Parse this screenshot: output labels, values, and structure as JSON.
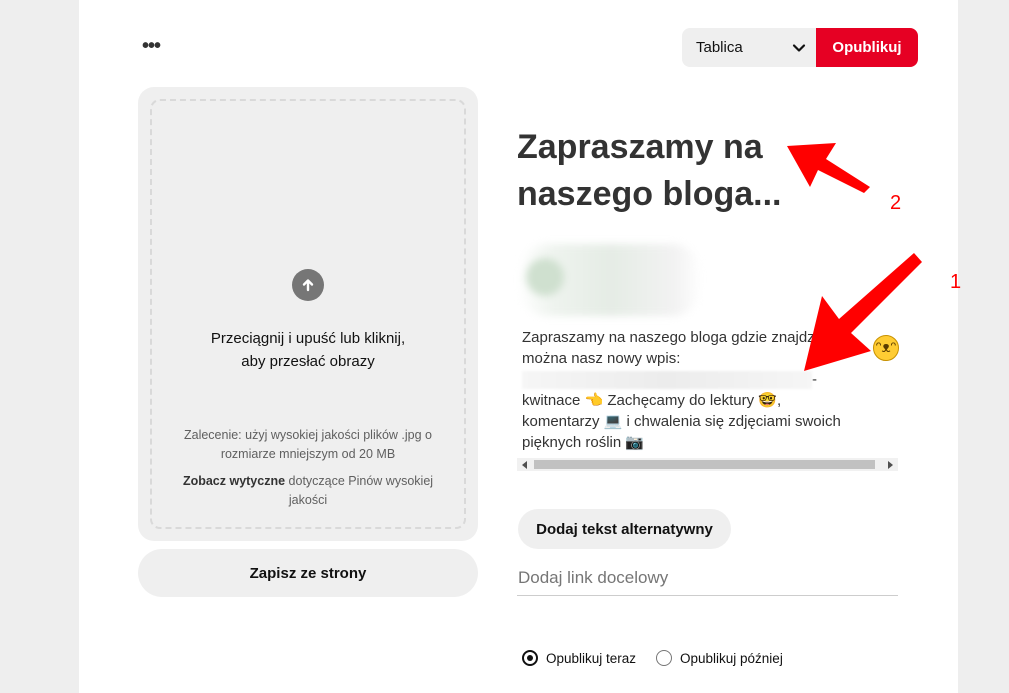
{
  "header": {
    "more_label": "•••",
    "board_select_value": "Tablica",
    "publish_label": "Opublikuj"
  },
  "upload": {
    "instruction_line1": "Przeciągnij i upuść lub kliknij,",
    "instruction_line2": "aby przesłać obrazy",
    "recommendation": "Zalecenie: użyj wysokiej jakości plików .jpg o rozmiarze mniejszym od 20 MB",
    "guidelines_link": "Zobacz wytyczne",
    "guidelines_rest": " dotyczące Pinów wysokiej jakości",
    "save_from_site_label": "Zapisz ze strony"
  },
  "pin": {
    "title": "Zapraszamy na naszego bloga...",
    "description": {
      "line1": "Zapraszamy na naszego bloga gdzie znajdziesz",
      "line2": "można nasz nowy wpis:",
      "line3_suffix": "-",
      "line4": "kwitnace 👈 Zachęcamy do lektury 🤓,",
      "line5": "komentarzy 💻 i chwalenia się zdjęciami swoich",
      "line6": "pięknych roślin 📷"
    },
    "alt_text_button_label": "Dodaj tekst alternatywny",
    "link_placeholder": "Dodaj link docelowy"
  },
  "publish_options": {
    "now_label": "Opublikuj teraz",
    "later_label": "Opublikuj później",
    "selected": "now"
  },
  "annotations": {
    "label_1": "1",
    "label_2": "2",
    "color": "#ff0000"
  }
}
